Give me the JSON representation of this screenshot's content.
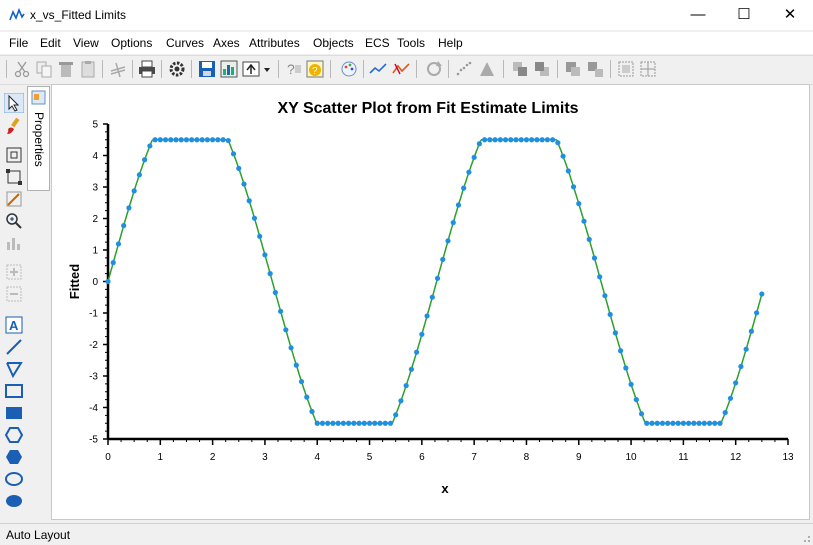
{
  "window": {
    "title": "x_vs_Fitted Limits",
    "minimize_glyph": "—",
    "maximize_glyph": "☐",
    "close_glyph": "✕"
  },
  "menu": [
    "File",
    "Edit",
    "View",
    "Options",
    "Curves",
    "Axes",
    "Attributes",
    "Objects",
    "ECS",
    "Tools",
    "Help"
  ],
  "toolbar_icons": [
    "cut-icon",
    "copy-icon",
    "delete-icon",
    "paste-icon",
    "link-icon",
    "print-icon",
    "settings-icon",
    "save-icon",
    "export-image-icon",
    "export-icon",
    "dropdown-icon",
    "help-pointer-icon",
    "help-icon",
    "palette-icon",
    "curve-icon",
    "curve-fit-icon",
    "rotate-icon",
    "scatter-icon",
    "triangle-icon",
    "bring-front-icon",
    "send-back-icon",
    "group-icon",
    "ungroup-icon",
    "layout-icon",
    "layout-align-icon"
  ],
  "left_tools": [
    "select-arrow-icon",
    "paint-brush-icon",
    "zoom-extents-icon",
    "zoom-box-icon",
    "draw-point-icon",
    "zoom-icon",
    "grid-icon",
    "add-axis-icon",
    "remove-axis-icon",
    "text-tool-icon",
    "line-tool-icon",
    "polyline-tool-icon",
    "rectangle-tool-icon",
    "filled-rectangle-tool-icon",
    "hexagon-tool-icon",
    "filled-hexagon-tool-icon",
    "ellipse-tool-icon",
    "filled-ellipse-tool-icon"
  ],
  "properties_tab": "Properties",
  "status": "Auto Layout",
  "colors": {
    "marker": "#1f8fe0",
    "fit_line": "#2ca02c",
    "accent": "#1060c0"
  },
  "chart_data": {
    "type": "scatter",
    "title": "XY Scatter Plot from Fit Estimate Limits",
    "xlabel": "x",
    "ylabel": "Fitted",
    "xlim": [
      0,
      13
    ],
    "ylim": [
      -5,
      5
    ],
    "xticks": [
      "0",
      "1",
      "2",
      "3",
      "4",
      "5",
      "6",
      "7",
      "8",
      "9",
      "10",
      "11",
      "12",
      "13"
    ],
    "yticks": [
      "5",
      "4",
      "3",
      "2",
      "1",
      "0",
      "-1",
      "-2",
      "-3",
      "-4",
      "-5"
    ],
    "x_range": [
      0,
      12.5
    ],
    "x_step": 0.1,
    "series": [
      {
        "style": "markers",
        "color": "#1f8fe0",
        "shape": "clipped sine",
        "amplitude_clip": 4.5,
        "formula": "y = clip(6*sin(x), -4.5, 4.5)"
      },
      {
        "style": "line",
        "color": "#2ca02c",
        "shape": "fitted curve",
        "formula": "y = clip(6*sin(x), -4.5, 4.5)"
      }
    ],
    "grid": false,
    "legend": "none"
  }
}
